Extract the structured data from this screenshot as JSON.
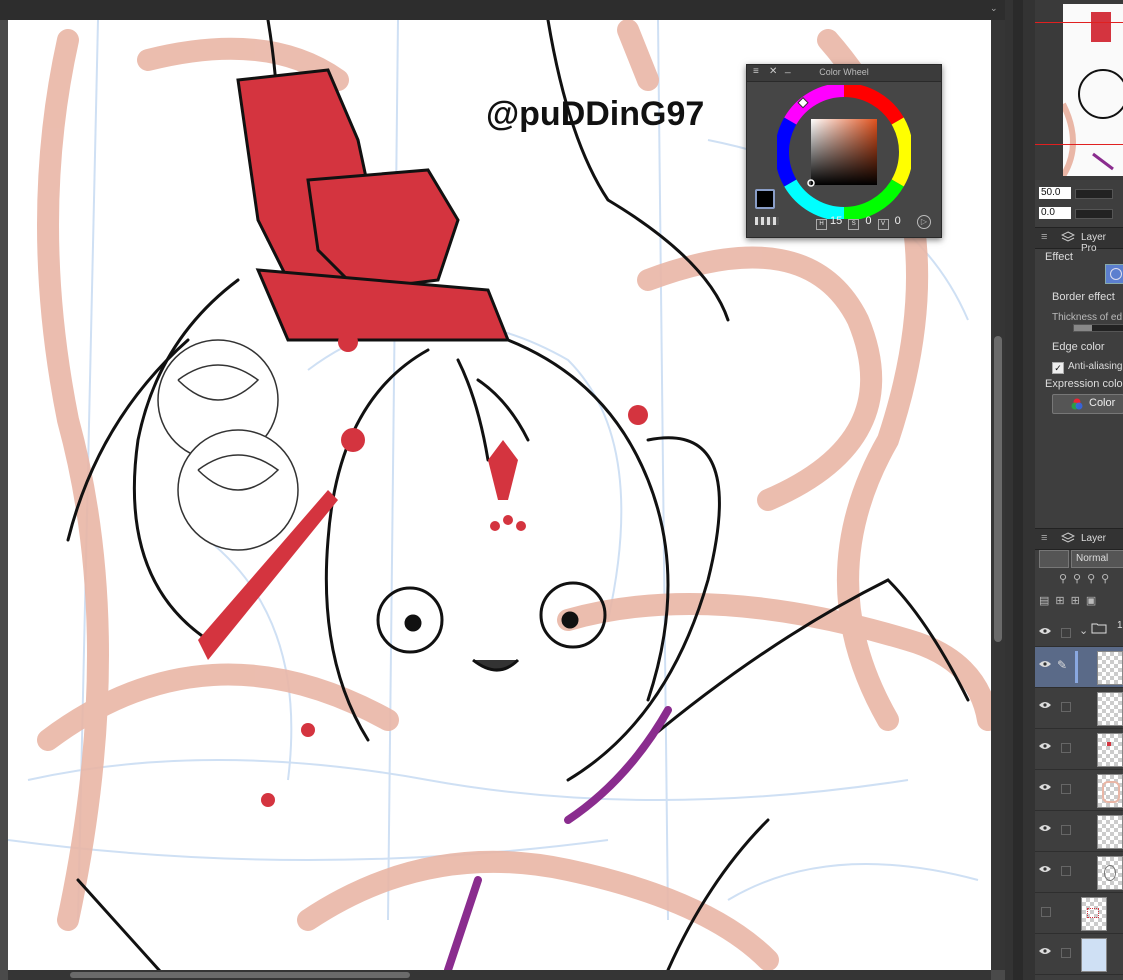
{
  "color_wheel": {
    "title": "Color Wheel",
    "h_value": "15",
    "s_value": "0",
    "v_value": "0"
  },
  "canvas": {
    "watermark": "@puDDinG97"
  },
  "navigator": {
    "zoom_value": "50.0",
    "rotate_value": "0.0"
  },
  "layer_property": {
    "header": "Layer Pro",
    "effect_label": "Effect",
    "border_effect_label": "Border effect",
    "thickness_label": "Thickness of ed",
    "edge_color_label": "Edge color",
    "anti_aliasing_label": "Anti-aliasing",
    "expression_color_label": "Expression colo",
    "color_button": "Color"
  },
  "layer_panel": {
    "header": "Layer",
    "blend_mode": "Normal",
    "folder_label": "1"
  },
  "colors": {
    "accent_red": "#d4343f",
    "sketch_blue": "#cfe0f4",
    "ribbon_salmon": "#e9b6a6"
  }
}
